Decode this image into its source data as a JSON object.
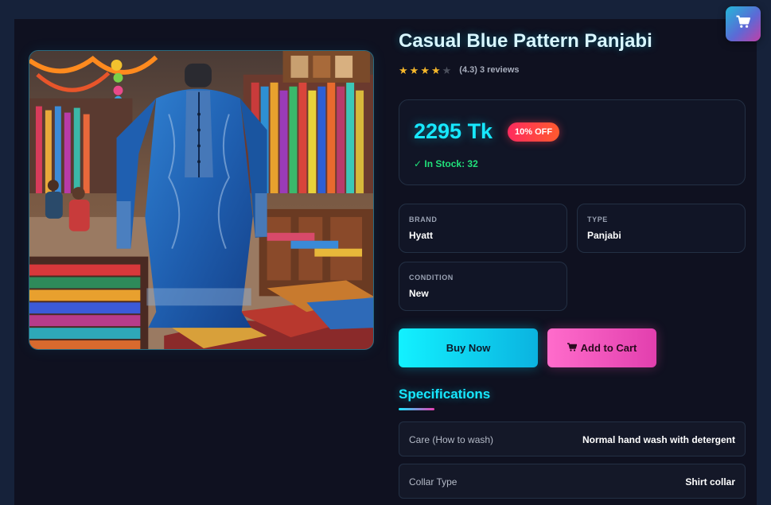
{
  "product": {
    "title": "Casual Blue Pattern Panjabi",
    "image_alt": "Blue embroidered panjabi on mannequin in textile market",
    "rating": {
      "stars_filled": 4,
      "stars_total": 5,
      "text": "(4.3) 3 reviews"
    },
    "price": "2295 Tk",
    "discount": "10% OFF",
    "stock": "✓ In Stock: 32"
  },
  "info": {
    "brand_label": "BRAND",
    "brand_value": "Hyatt",
    "type_label": "TYPE",
    "type_value": "Panjabi",
    "condition_label": "CONDITION",
    "condition_value": "New"
  },
  "actions": {
    "buy_now": "Buy Now",
    "add_to_cart": "Add to Cart"
  },
  "specifications": {
    "heading": "Specifications",
    "rows": [
      {
        "key": "Care (How to wash)",
        "value": "Normal hand wash with detergent"
      },
      {
        "key": "Collar Type",
        "value": "Shirt collar"
      }
    ]
  },
  "icons": {
    "floating_cart": "cart-icon",
    "add_to_cart": "cart-icon",
    "star": "star-icon"
  },
  "colors": {
    "accent_cyan": "#17e8ff",
    "accent_pink": "#e83fb4",
    "stock_green": "#21e07a",
    "discount_red": "#ff2b5e",
    "star_gold": "#f5b72b"
  }
}
